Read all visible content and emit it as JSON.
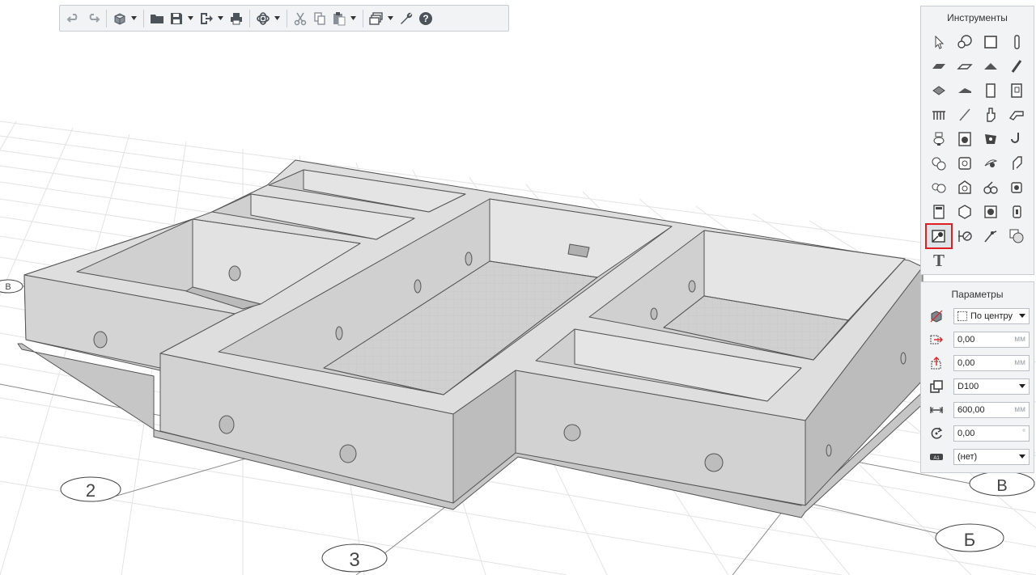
{
  "toolbar": {
    "buttons": [
      "undo-icon",
      "redo-icon",
      "view-cube-icon",
      "open-folder-icon",
      "save-icon",
      "export-icon",
      "print-icon",
      "orbit-icon",
      "cut-icon",
      "copy-icon",
      "paste-icon",
      "layers-icon",
      "settings-wrench-icon",
      "help-icon"
    ]
  },
  "instruments": {
    "title": "Инструменты",
    "active_tool": "opening-tool",
    "text_tool_label": "T"
  },
  "params": {
    "title": "Параметры",
    "anchor": "По центру",
    "offset_x": "0,00",
    "offset_y": "0,00",
    "unit_mm": "мм",
    "size": "D100",
    "depth": "600,00",
    "angle": "0,00",
    "angle_unit": "°",
    "layer": "(нет)"
  },
  "viewport": {
    "axis_labels": [
      "2",
      "3",
      "В",
      "Б",
      "В"
    ]
  },
  "colors": {
    "accent_red": "#e02020",
    "panel_bg": "#f2f3f5",
    "model_gray": "#d9d9d9"
  }
}
